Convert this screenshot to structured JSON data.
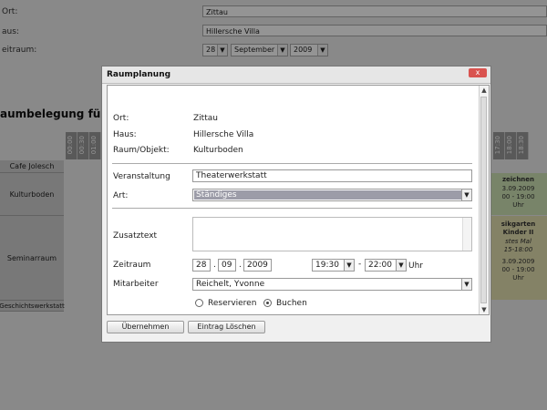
{
  "background": {
    "ort_label": "Ort:",
    "ort_value": "Zittau",
    "haus_label": "aus:",
    "haus_value": "Hillersche Villa",
    "zeitraum_label": "eitraum:",
    "day": "28",
    "month": "September",
    "year": "2009",
    "title": "aumbelegung für Zitta",
    "hours": [
      "00:00",
      "00:30",
      "01:00"
    ],
    "right_hours": [
      "17:30",
      "18:00",
      "18:30"
    ],
    "rooms": [
      "Cafe Jolesch",
      "Kulturboden",
      "Seminarraum",
      "Geschichtswerkstatt"
    ],
    "event1": [
      "zeichnen",
      "3.09.2009",
      "00 - 19:00",
      "Uhr"
    ],
    "event2": [
      "sikgarten",
      "Kinder II",
      "stes Mal",
      "15-18:00",
      "3.09.2009",
      "00 - 19:00",
      "Uhr"
    ]
  },
  "modal": {
    "title": "Raumplanung",
    "close": "x",
    "ort_label": "Ort:",
    "ort_value": "Zittau",
    "haus_label": "Haus:",
    "haus_value": "Hillersche Villa",
    "raum_label": "Raum/Objekt:",
    "raum_value": "Kulturboden",
    "veranstaltung_label": "Veranstaltung",
    "veranstaltung_value": "Theaterwerkstatt",
    "art_label": "Art:",
    "art_value": "Ständiges",
    "zusatztext_label": "Zusatztext",
    "zeitraum_label": "Zeitraum",
    "day": "28",
    "month": "09",
    "year": "2009",
    "dot": ".",
    "time_from": "19:30",
    "dash": "-",
    "time_to": "22:00",
    "uhr": "Uhr",
    "mitarbeiter_label": "Mitarbeiter",
    "mitarbeiter_value": "Reichelt, Yvonne",
    "radio_reservieren": "Reservieren",
    "radio_buchen": "Buchen",
    "btn_apply": "Übernehmen",
    "btn_delete": "Eintrag Löschen"
  }
}
